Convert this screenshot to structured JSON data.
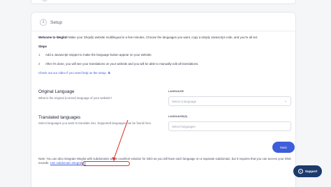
{
  "top_card": {},
  "setup": {
    "step_number": "1",
    "title": "Setup",
    "intro_bold": "Welcome to Weglot!",
    "intro_rest": " Make your Shopify website multilingual in a few minutes. Choose the languages you want, copy a simply Javascript code, and you're all set.",
    "steps_label": "Steps",
    "steps": [
      {
        "num": "1",
        "text": "Add a Javascript snippet to make the language button appear on your website."
      },
      {
        "num": "2",
        "text": "After it's done, you will see your translations on your website and you will be able to manually edit all translations."
      }
    ],
    "video_link": "Check out our video if you need help on the setup."
  },
  "original_language": {
    "title": "Original Language",
    "description": "What is the original (current) language of your website?",
    "field_label": "LANGUAGE",
    "placeholder": "Select a language"
  },
  "translated_languages": {
    "title": "Translated languages",
    "description": "Select languages you want to translate into. Supported languages can be found here.",
    "field_label": "LANGUAGE(S)",
    "placeholder": "Select languages"
  },
  "next_button": "Next",
  "note": {
    "text": "Note: You can also integrate Weglot with subdomains as an excellent solution for SEO as you will have each language on a separate subdomain, but it requires that you can access your DNS records.",
    "link": "Use subdomain integration"
  },
  "support_button": "Support",
  "colors": {
    "accent": "#3e5ed9",
    "annotation": "#e0322f",
    "support_bg": "#1c3a6b"
  }
}
